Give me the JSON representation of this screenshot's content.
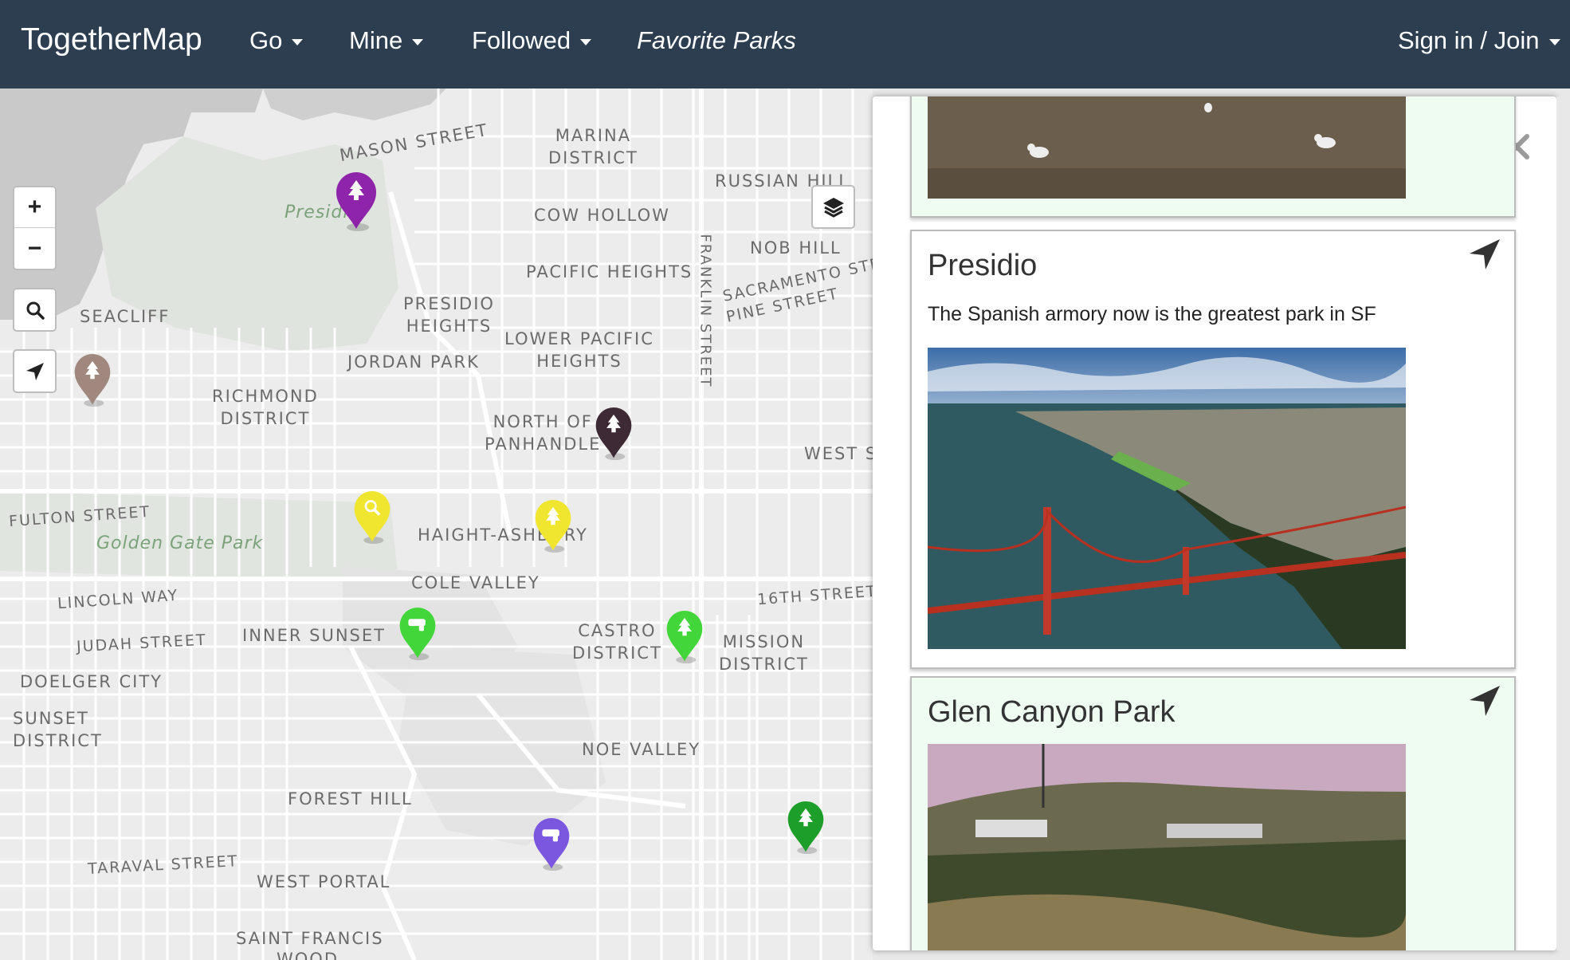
{
  "navbar": {
    "brand": "TogetherMap",
    "items": [
      {
        "label": "Go"
      },
      {
        "label": "Mine"
      },
      {
        "label": "Followed"
      }
    ],
    "current_map": "Favorite Parks",
    "signin_label": "Sign in / Join"
  },
  "map": {
    "labels": [
      {
        "text": "MASON STREET"
      },
      {
        "text": "MARINA\nDISTRICT"
      },
      {
        "text": "RUSSIAN HILL"
      },
      {
        "text": "COW HOLLOW"
      },
      {
        "text": "NOB HILL"
      },
      {
        "text": "FRANKLIN STREET"
      },
      {
        "text": "SACRAMENTO STR"
      },
      {
        "text": "PINE STREET"
      },
      {
        "text": "PACIFIC HEIGHTS"
      },
      {
        "text": "PRESIDIO\nHEIGHTS"
      },
      {
        "text": "LOWER PACIFIC\nHEIGHTS"
      },
      {
        "text": "JORDAN PARK"
      },
      {
        "text": "SEACLIFF"
      },
      {
        "text": "RICHMOND\nDISTRICT"
      },
      {
        "text": "NORTH OF\nPANHANDLE"
      },
      {
        "text": "WEST S"
      },
      {
        "text": "FULTON STREET"
      },
      {
        "text": "HAIGHT-ASHBURY"
      },
      {
        "text": "COLE VALLEY"
      },
      {
        "text": "LINCOLN WAY"
      },
      {
        "text": "16TH STREET"
      },
      {
        "text": "INNER SUNSET"
      },
      {
        "text": "JUDAH STREET"
      },
      {
        "text": "CASTRO\nDISTRICT"
      },
      {
        "text": "MISSION\nDISTRICT"
      },
      {
        "text": "DOELGER CITY"
      },
      {
        "text": "SUNSET\nDISTRICT"
      },
      {
        "text": "NOE VALLEY"
      },
      {
        "text": "FOREST HILL"
      },
      {
        "text": "TARAVAL STREET"
      },
      {
        "text": "WEST PORTAL"
      },
      {
        "text": "SAINT FRANCIS"
      },
      {
        "text": "WOOD"
      }
    ],
    "park_labels": [
      {
        "text": "Presidio"
      },
      {
        "text": "Golden Gate Park"
      }
    ],
    "controls": {
      "zoom_in": "+",
      "zoom_out": "−"
    },
    "markers": [
      {
        "name": "presidio-marker",
        "color": "#8e24aa",
        "icon": "tree-icon"
      },
      {
        "name": "seacliff-marker",
        "color": "#a1887f",
        "icon": "tree-icon"
      },
      {
        "name": "panhandle-marker",
        "color": "#3e2a35",
        "icon": "tree-icon"
      },
      {
        "name": "ggpark-marker",
        "color": "#f0e630",
        "icon": "magnifier-icon"
      },
      {
        "name": "haight-marker",
        "color": "#f0e630",
        "icon": "tree-icon"
      },
      {
        "name": "inner-sunset-marker",
        "color": "#43d63a",
        "icon": "binoculars-icon"
      },
      {
        "name": "castro-marker",
        "color": "#43d63a",
        "icon": "tree-icon"
      },
      {
        "name": "glen-canyon-marker",
        "color": "#7b57e0",
        "icon": "binoculars-icon"
      },
      {
        "name": "bernal-marker",
        "color": "#1d9e2a",
        "icon": "tree-icon"
      }
    ]
  },
  "panel": {
    "cards": [
      {
        "title": "Presidio",
        "description": "The Spanish armory now is the greatest park in SF",
        "image": "golden-gate-bridge-aerial"
      },
      {
        "title": "Glen Canyon Park",
        "image": "glen-canyon-landscape"
      }
    ],
    "top_card_image": "seagulls-on-beach"
  },
  "colors": {
    "navbar": "#2c3e50",
    "card_tint": "#effcf2"
  }
}
